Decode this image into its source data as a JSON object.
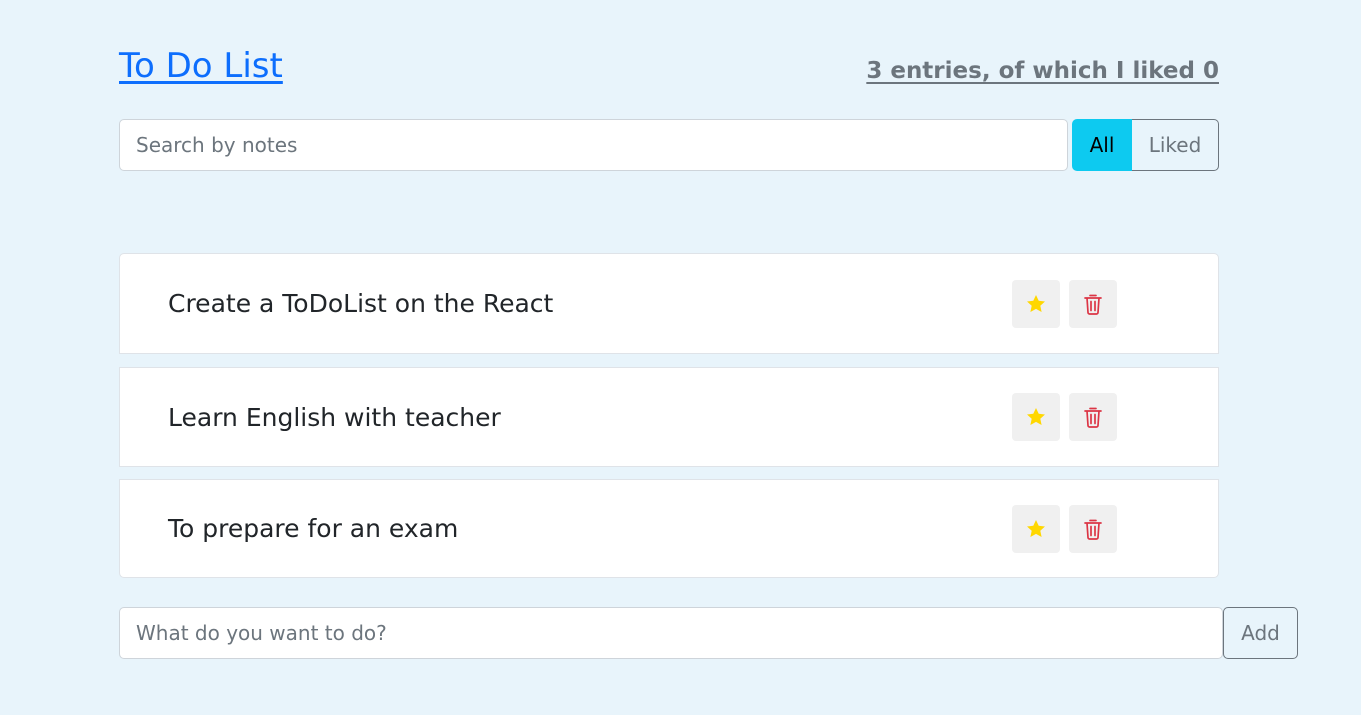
{
  "header": {
    "title": "To Do List",
    "counter": "3 entries, of which I liked 0"
  },
  "search": {
    "placeholder": "Search by notes",
    "value": ""
  },
  "filters": {
    "all_label": "All",
    "liked_label": "Liked",
    "selected": "All"
  },
  "todos": [
    {
      "label": "Create a ToDoList on the React",
      "liked": false
    },
    {
      "label": "Learn English with teacher",
      "liked": false
    },
    {
      "label": "To prepare for an exam",
      "liked": false
    }
  ],
  "add_form": {
    "placeholder": "What do you want to do?",
    "value": "",
    "button_label": "Add"
  },
  "icons": {
    "star": "star-icon",
    "trash": "trash-icon"
  },
  "colors": {
    "background": "#e8f4fb",
    "title_link": "#0d6efd",
    "filter_active": "#0dcaf0",
    "star": "#ffd700",
    "trash": "#dc3545",
    "muted": "#6c757d"
  }
}
